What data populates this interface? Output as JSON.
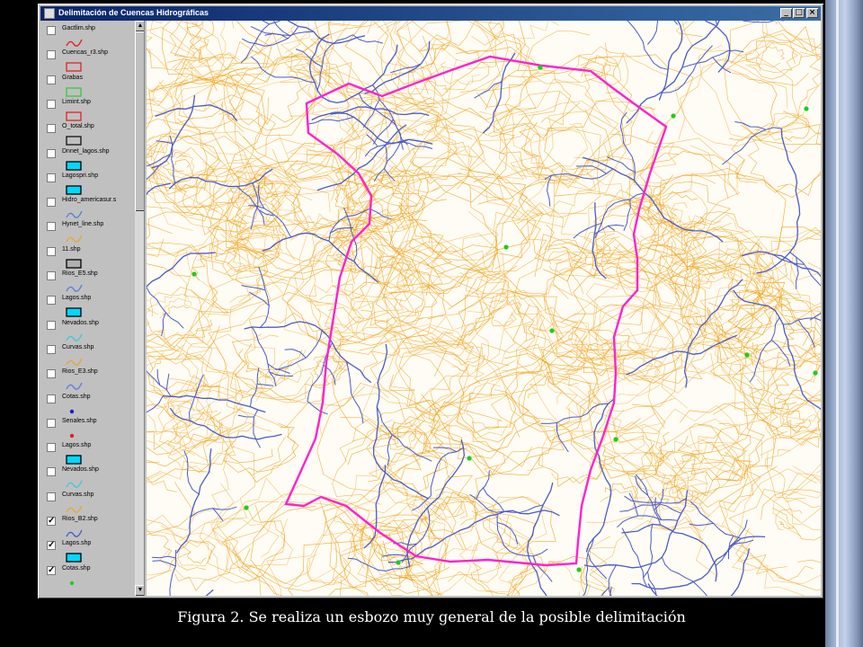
{
  "window": {
    "title": "Delimitación de Cuencas Hidrográficas",
    "buttons": [
      "minimize-icon",
      "maximize-icon",
      "close-icon"
    ]
  },
  "legend": {
    "items": [
      {
        "label": "Gactlim.shp",
        "checked": false,
        "symbol": "line",
        "color": "#e52020"
      },
      {
        "label": "Cuencas_r3.shp",
        "checked": false,
        "symbol": "box",
        "color": "#e52020"
      },
      {
        "label": "Grabas",
        "checked": false,
        "symbol": "box",
        "color": "#33cc33"
      },
      {
        "label": "Limint.shp",
        "checked": false,
        "symbol": "box",
        "color": "#e52020"
      },
      {
        "label": "O_total.shp",
        "checked": false,
        "symbol": "box",
        "color": "#111111"
      },
      {
        "label": "Dnnet_lagos.shp",
        "checked": false,
        "symbol": "fill",
        "color": "#00d8ff"
      },
      {
        "label": "Lagospri.shp",
        "checked": false,
        "symbol": "fill",
        "color": "#00d8ff"
      },
      {
        "label": "Hidro_americasur.s",
        "checked": false,
        "symbol": "line",
        "color": "#5b7fe0"
      },
      {
        "label": "Hynet_line.shp",
        "checked": false,
        "symbol": "line",
        "color": "#e8a830"
      },
      {
        "label": "11.shp",
        "checked": false,
        "symbol": "fill",
        "color": "#b0b0b0"
      },
      {
        "label": "Rios_E5.shp",
        "checked": false,
        "symbol": "line",
        "color": "#5b7fe0"
      },
      {
        "label": "Lagos.shp",
        "checked": false,
        "symbol": "fill",
        "color": "#00d8ff"
      },
      {
        "label": "Nevados.shp",
        "checked": false,
        "symbol": "line",
        "color": "#40c8e0"
      },
      {
        "label": "Curvas.shp",
        "checked": false,
        "symbol": "line",
        "color": "#e8a830"
      },
      {
        "label": "Rios_E3.shp",
        "checked": false,
        "symbol": "line",
        "color": "#5b7fe0"
      },
      {
        "label": "Cotas.shp",
        "checked": false,
        "symbol": "dot",
        "color": "#1020c0"
      },
      {
        "label": "Senales.shp",
        "checked": false,
        "symbol": "dot",
        "color": "#e52020"
      },
      {
        "label": "Lagos.shp",
        "checked": false,
        "symbol": "fill",
        "color": "#00d8ff"
      },
      {
        "label": "Nevados.shp",
        "checked": false,
        "symbol": "line",
        "color": "#40c8e0"
      },
      {
        "label": "Curvas.shp",
        "checked": false,
        "symbol": "line",
        "color": "#e8a830"
      },
      {
        "label": "Rios_B2.shp",
        "checked": true,
        "symbol": "line",
        "color": "#4a5ec8"
      },
      {
        "label": "Lagos.shp",
        "checked": true,
        "symbol": "fill",
        "color": "#00d8ff"
      },
      {
        "label": "Cotas.shp",
        "checked": true,
        "symbol": "dot",
        "color": "#22cc22"
      }
    ]
  },
  "map": {
    "contour_color": "#f0a21a",
    "river_color": "#4b5bc6",
    "boundary_color": "#ff22cc",
    "point_color": "#1fcc1f"
  },
  "caption": "Figura 2. Se realiza un esbozo muy general de la posible delimitación"
}
